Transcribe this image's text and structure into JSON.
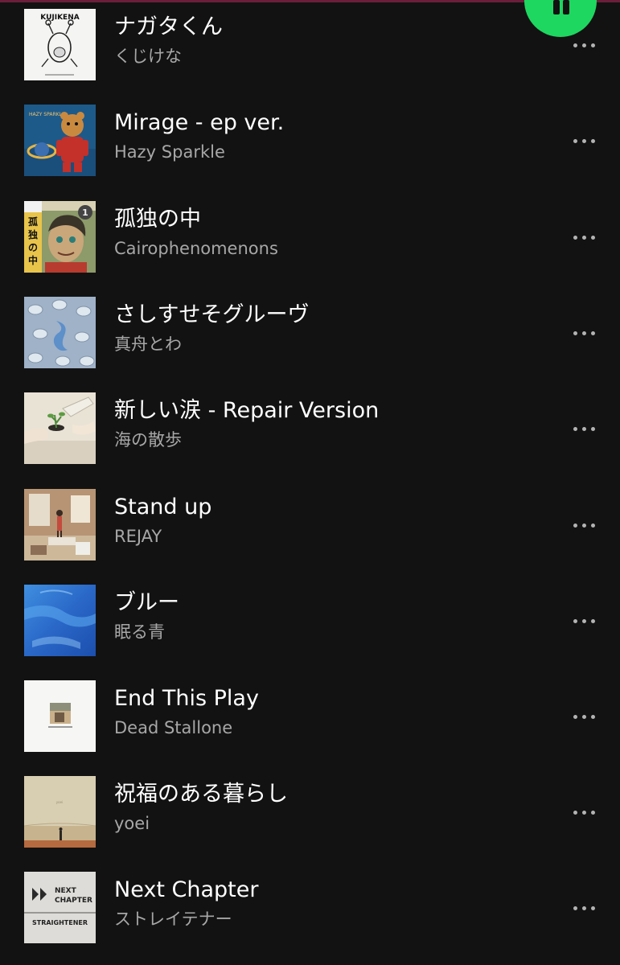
{
  "player": {
    "accent_color": "#1ed760",
    "play_state_icon": "pause-icon"
  },
  "tracks": [
    {
      "title": "ナガタくん",
      "artist": "くじけな",
      "cover_text": "KUJIKENA"
    },
    {
      "title": "Mirage - ep ver.",
      "artist": "Hazy Sparkle",
      "cover_text": "HAZY SPARKLE"
    },
    {
      "title": "孤独の中",
      "artist": "Cairophenomenons",
      "cover_text": "孤独の中"
    },
    {
      "title": "さしすせそグルーヴ",
      "artist": "真舟とわ",
      "cover_text": ""
    },
    {
      "title": "新しい涙 - Repair Version",
      "artist": "海の散歩",
      "cover_text": ""
    },
    {
      "title": "Stand up",
      "artist": "REJAY",
      "cover_text": ""
    },
    {
      "title": "ブルー",
      "artist": "眠る青",
      "cover_text": ""
    },
    {
      "title": "End This Play",
      "artist": "Dead Stallone",
      "cover_text": ""
    },
    {
      "title": "祝福のある暮らし",
      "artist": "yoei",
      "cover_text": ""
    },
    {
      "title": "Next Chapter",
      "artist": "ストレイテナー",
      "cover_text": "NEXT CHAPTER STRAIGHTENER"
    }
  ],
  "more_options_icon": "more-options-icon"
}
